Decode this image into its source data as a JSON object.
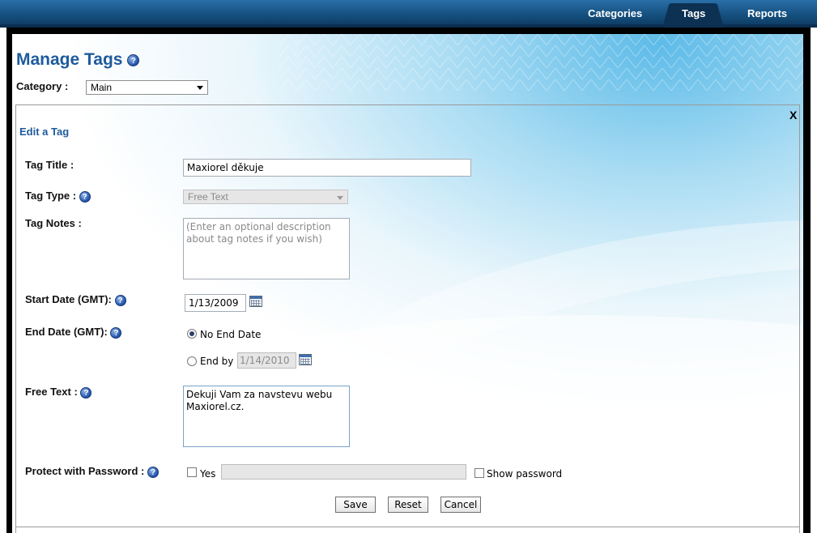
{
  "nav": {
    "tabs": [
      {
        "label": "Categories",
        "active": false
      },
      {
        "label": "Tags",
        "active": true
      },
      {
        "label": "Reports",
        "active": false
      }
    ]
  },
  "page": {
    "title": "Manage Tags",
    "help_glyph": "?",
    "category_label": "Category :",
    "category_value": "Main"
  },
  "edit": {
    "close": "X",
    "section_title": "Edit a Tag",
    "tag_title_label": "Tag Title :",
    "tag_title_value": "Maxiorel děkuje",
    "tag_type_label": "Tag Type :",
    "tag_type_value": "Free Text",
    "tag_notes_label": "Tag Notes :",
    "tag_notes_placeholder": "(Enter an optional description about tag notes if you wish)",
    "start_date_label": "Start Date (GMT):",
    "start_date_value": "1/13/2009",
    "end_date_label": "End Date (GMT):",
    "no_end_date_label": "No End Date",
    "end_by_label": "End by :",
    "end_by_value": "1/14/2010",
    "free_text_label": "Free Text :",
    "free_text_value": "Dekuji Vam za navstevu webu Maxiorel.cz.",
    "protect_label": "Protect with Password :",
    "yes_label": "Yes",
    "show_password_label": "Show password"
  },
  "buttons": {
    "save": "Save",
    "reset": "Reset",
    "cancel": "Cancel"
  },
  "colors": {
    "accent": "#1e5a9c",
    "topbar": "#15507f"
  },
  "icons": [
    "help-icon",
    "calendar-icon",
    "dropdown-arrow-icon"
  ]
}
